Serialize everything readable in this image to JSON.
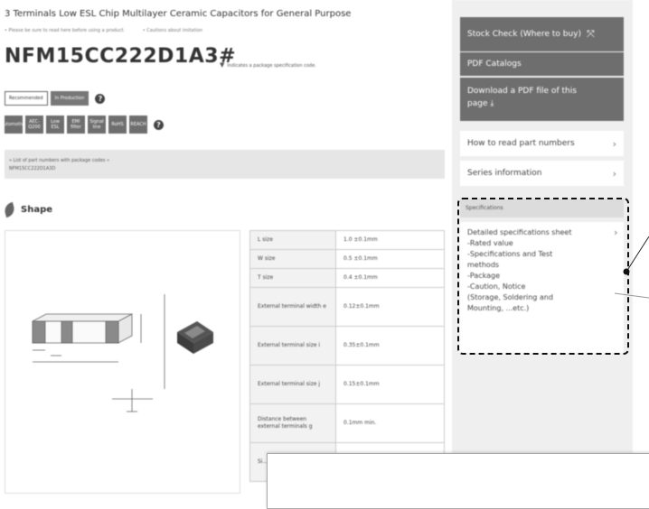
{
  "header": {
    "product_subtitle": "3 Terminals Low ESL Chip Multilayer Ceramic Capacitors for General Purpose",
    "note_caution": "• Please be sure to read here before using a product.",
    "note_link": "• Cautions about imitation",
    "part_number": "NFM15CC222D1A3#",
    "package_link": "Indicates a package specification code."
  },
  "tags": [
    {
      "label": "Recommended",
      "style": "outline"
    },
    {
      "label": "In Production",
      "style": "dark"
    }
  ],
  "features": [
    {
      "label": "Automotive"
    },
    {
      "label": "AEC-Q200"
    },
    {
      "label": "Low ESL"
    },
    {
      "label": "EMI filter"
    },
    {
      "label": "Signal line"
    },
    {
      "label": "RoHS"
    },
    {
      "label": "REACH"
    }
  ],
  "package_codes": {
    "line1": "« List of part numbers with package codes »",
    "line2": "NFM15CC222D1A3D"
  },
  "shape": {
    "title": "Shape"
  },
  "spec_table": [
    {
      "key": "L size",
      "value": "1.0 ±0.1mm"
    },
    {
      "key": "W size",
      "value": "0.5 ±0.1mm"
    },
    {
      "key": "T size",
      "value": "0.4 ±0.1mm"
    },
    {
      "key": "External terminal width e",
      "value": "0.12±0.1mm"
    },
    {
      "key": "External terminal size i",
      "value": "0.35±0.1mm"
    },
    {
      "key": "External terminal size j",
      "value": "0.15±0.1mm"
    },
    {
      "key": "Distance between external terminals g",
      "value": "0.1mm min."
    },
    {
      "key": "Si...",
      "value": ""
    }
  ],
  "sidebar": {
    "stock_check": "Stock Check (Where to buy)",
    "pdf_catalog": "PDF Catalogs",
    "download_line1": "Download a PDF file of this",
    "download_line2": "page",
    "read_part_numbers": "How to read part numbers",
    "series_info": "Series information",
    "specifications_header": "Specifications",
    "spec_lines": [
      "Detailed specifications sheet",
      "-Rated value",
      "-Specifications and Test",
      "methods",
      "-Package",
      "-Caution, Notice",
      "(Storage, Soldering and",
      "Mounting, ...etc.)"
    ]
  },
  "colors": {
    "button_gray": "#6e6e6e",
    "sidebar_bg": "#efefef",
    "highlight": "#111111"
  }
}
